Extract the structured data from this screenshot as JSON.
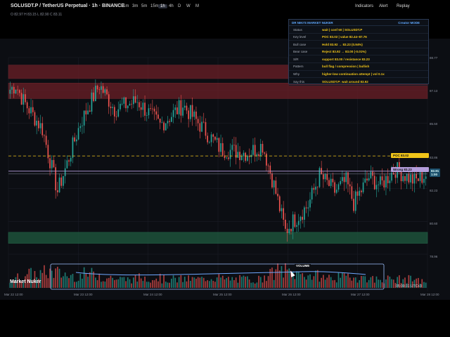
{
  "toolbar": {
    "symbol_title": "SOLUSDT.P / TetherUS Perpetual · 1h · BINANCE",
    "timeframes": [
      "1m",
      "3m",
      "5m",
      "15m",
      "1h",
      "4h",
      "D",
      "W",
      "M"
    ],
    "active_timeframe": "1h",
    "indicators_label": "Indicators",
    "alert_label": "Alert",
    "replay_label": "Replay"
  },
  "legend_ohlc": "O 82.97 H 83.15 L 82.90 C 83.11",
  "panel": {
    "title": "DR NIKI'S MARKET NUKER",
    "mode": "Creator MODE",
    "rows": [
      {
        "k": "Status",
        "v": "wait | conf 50 | SOLUSDT.P"
      },
      {
        "k": "Key level",
        "v": "POC 83.02 | value 82.44–87.76"
      },
      {
        "k": "Bull case",
        "v": "Hold 83.92 → 83.23 (0.94%)"
      },
      {
        "k": "Bear case",
        "v": "Reject 83.92 → 83.00 (-0.01%)"
      },
      {
        "k": "S/R",
        "v": "support 83.00 / resistance 83.23"
      },
      {
        "k": "Pattern",
        "v": "bull flag / compression | bullish"
      },
      {
        "k": "Why",
        "v": "higher-low continuation attempt | vol 0.1x"
      },
      {
        "k": "Say this",
        "v": "SOLUSDT.P: wait around 83.92"
      }
    ]
  },
  "brand": "Market Nuker",
  "clock": "05:09:31 UTC+3",
  "volume_label": "VOLUME",
  "chart_data": {
    "type": "candlestick",
    "symbol": "SOLUSDT.P",
    "timeframe": "1h",
    "y_ticks": [
      "88.77",
      "87.13",
      "85.50",
      "83.86",
      "82.23",
      "80.60",
      "78.96"
    ],
    "ylim": [
      78.96,
      88.77
    ],
    "x_ticks": [
      "Mar 22 12:00",
      "Mar 23 12:00",
      "Mar 24 12:00",
      "Mar 25 12:00",
      "Mar 26 12:00",
      "Mar 27 12:00",
      "Mar 28 12:00"
    ],
    "last_price": 82.91,
    "last_price_label": "82.91",
    "timer_label": "1:00",
    "levels": [
      {
        "name": "POC",
        "value": 83.86,
        "label": "POC 83.02",
        "color": "#f0c419",
        "style": "dashed"
      },
      {
        "name": "Wrong",
        "value": 83.1,
        "label": "Wrong 83.23",
        "color": "#b39ddb",
        "style": "solid"
      }
    ],
    "zones": [
      {
        "type": "supply",
        "top": 88.4,
        "bottom": 87.72,
        "color": "#6b1f26"
      },
      {
        "type": "supply",
        "top": 87.5,
        "bottom": 86.72,
        "color": "#6b1f26"
      },
      {
        "type": "demand",
        "top": 80.05,
        "bottom": 79.5,
        "color": "#1f5a40"
      }
    ],
    "segments": [
      {
        "count": 4,
        "start": 87.1,
        "end": 87.4,
        "vol": 0.5
      },
      {
        "count": 4,
        "start": 87.4,
        "end": 86.6,
        "vol": 0.6
      },
      {
        "count": 10,
        "start": 86.6,
        "end": 85.2,
        "vol": 0.8
      },
      {
        "count": 8,
        "start": 85.2,
        "end": 82.1,
        "vol": 0.9
      },
      {
        "count": 4,
        "start": 82.1,
        "end": 83.2,
        "vol": 0.8
      },
      {
        "count": 8,
        "start": 83.2,
        "end": 85.5,
        "vol": 0.7
      },
      {
        "count": 10,
        "start": 85.5,
        "end": 87.4,
        "vol": 0.8
      },
      {
        "count": 8,
        "start": 87.4,
        "end": 86.2,
        "vol": 0.6
      },
      {
        "count": 12,
        "start": 86.2,
        "end": 86.6,
        "vol": 0.5
      },
      {
        "count": 12,
        "start": 86.6,
        "end": 85.4,
        "vol": 0.6
      },
      {
        "count": 12,
        "start": 85.4,
        "end": 86.4,
        "vol": 0.5
      },
      {
        "count": 10,
        "start": 86.4,
        "end": 85.3,
        "vol": 0.5
      },
      {
        "count": 10,
        "start": 85.3,
        "end": 84.2,
        "vol": 0.6
      },
      {
        "count": 14,
        "start": 84.2,
        "end": 84.0,
        "vol": 0.5
      },
      {
        "count": 8,
        "start": 84.0,
        "end": 84.4,
        "vol": 0.5
      },
      {
        "count": 6,
        "start": 84.4,
        "end": 82.4,
        "vol": 0.8
      },
      {
        "count": 6,
        "start": 82.4,
        "end": 80.1,
        "vol": 1.0
      },
      {
        "count": 4,
        "start": 80.1,
        "end": 80.6,
        "vol": 0.9
      },
      {
        "count": 8,
        "start": 80.6,
        "end": 81.4,
        "vol": 0.8
      },
      {
        "count": 6,
        "start": 81.4,
        "end": 82.9,
        "vol": 0.7
      },
      {
        "count": 8,
        "start": 82.9,
        "end": 82.1,
        "vol": 0.6
      },
      {
        "count": 6,
        "start": 82.1,
        "end": 82.6,
        "vol": 0.6
      },
      {
        "count": 4,
        "start": 82.6,
        "end": 81.5,
        "vol": 0.7
      },
      {
        "count": 8,
        "start": 81.5,
        "end": 82.8,
        "vol": 0.6
      },
      {
        "count": 6,
        "start": 82.8,
        "end": 82.4,
        "vol": 0.5
      },
      {
        "count": 8,
        "start": 82.4,
        "end": 83.2,
        "vol": 0.5
      },
      {
        "count": 10,
        "start": 83.2,
        "end": 82.6,
        "vol": 0.5
      },
      {
        "count": 6,
        "start": 82.6,
        "end": 82.91,
        "vol": 0.4
      }
    ],
    "colors": {
      "up": "#26a69a",
      "down": "#ef5350",
      "grid": "#1a1d26",
      "volume_box": "#9ec1ff",
      "volume_line": "#6fa8ff"
    }
  }
}
